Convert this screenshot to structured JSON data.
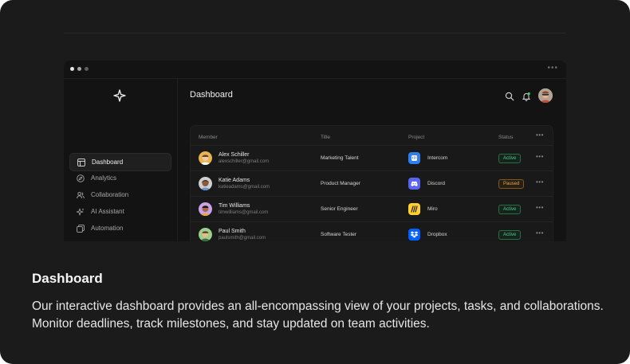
{
  "app": {
    "page_title": "Dashboard"
  },
  "sidebar": {
    "items": [
      {
        "label": "Dashboard",
        "icon": "layout-icon",
        "active": true
      },
      {
        "label": "Analytics",
        "icon": "compass-icon",
        "active": false
      },
      {
        "label": "Collaboration",
        "icon": "users-icon",
        "active": false
      },
      {
        "label": "AI Assistant",
        "icon": "sparkles-icon",
        "active": false
      },
      {
        "label": "Automation",
        "icon": "copy-icon",
        "active": false
      }
    ]
  },
  "table": {
    "headers": {
      "member": "Member",
      "title": "Title",
      "project": "Project",
      "status": "Status"
    },
    "rows": [
      {
        "name": "Alex Schiller",
        "email": "alexschiller@gmail.com",
        "title": "Marketing Talent",
        "project": "Intercom",
        "status": "Active",
        "status_type": "active",
        "project_color": "#2f80ed",
        "avatar_color": "#e7b450"
      },
      {
        "name": "Katie Adams",
        "email": "katieadams@gmail.com",
        "title": "Product Manager",
        "project": "Discord",
        "status": "Paused",
        "status_type": "paused",
        "project_color": "#5865f2",
        "avatar_color": "#cfcfcf"
      },
      {
        "name": "Tim Williams",
        "email": "timwilliams@gmail.com",
        "title": "Senior Engineer",
        "project": "Miro",
        "status": "Active",
        "status_type": "active",
        "project_color": "#ffd02f",
        "avatar_color": "#c9a2e8"
      },
      {
        "name": "Paul Smith",
        "email": "paulsmith@gmail.com",
        "title": "Software Tester",
        "project": "Dropbox",
        "status": "Active",
        "status_type": "active",
        "project_color": "#0061fe",
        "avatar_color": "#9ccf8a"
      }
    ]
  },
  "description": {
    "title": "Dashboard",
    "text": "Our interactive dashboard provides an all-encompassing view of your projects, tasks, and collaborations. Monitor deadlines, track milestones, and stay updated on team activities."
  },
  "colors": {
    "card_bg": "#1b1b1b",
    "app_bg": "#131313",
    "active_status": "#4ec88a",
    "paused_status": "#e0a64a"
  }
}
